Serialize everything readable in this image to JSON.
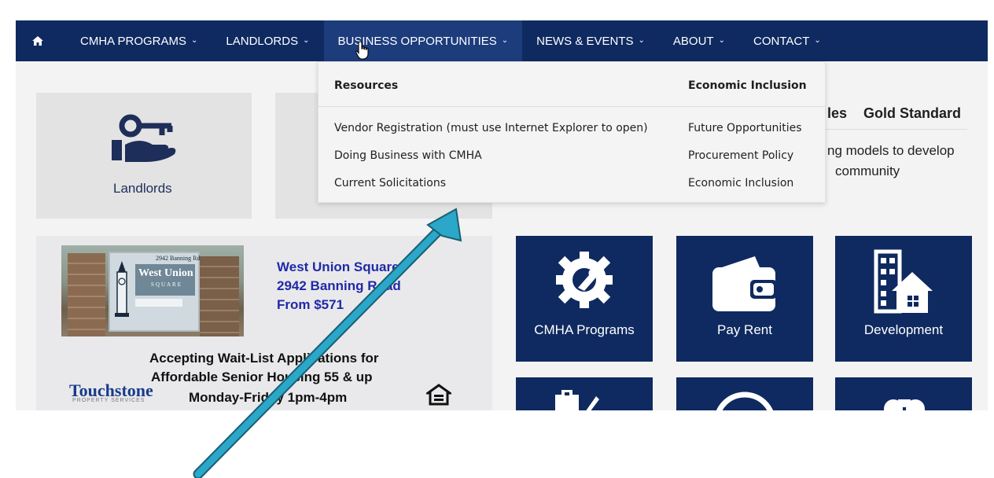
{
  "nav": {
    "home_icon": "home-icon",
    "items": [
      {
        "label": "CMHA PROGRAMS"
      },
      {
        "label": "LANDLORDS"
      },
      {
        "label": "BUSINESS OPPORTUNITIES"
      },
      {
        "label": "NEWS & EVENTS"
      },
      {
        "label": "ABOUT"
      },
      {
        "label": "CONTACT"
      }
    ],
    "caret": "⌄"
  },
  "dropdown": {
    "col1_header": "Resources",
    "col2_header": "Economic Inclusion",
    "col1_links": [
      "Vendor Registration (must use Internet Explorer to open)",
      "Doing Business with CMHA",
      "Current Solicitations"
    ],
    "col2_links": [
      "Future Opportunities",
      "Procurement Policy",
      "Economic Inclusion"
    ]
  },
  "tiles": {
    "landlords_label": "Landlords",
    "blue": [
      {
        "label": "CMHA Programs",
        "icon": "gear-wrench-icon"
      },
      {
        "label": "Pay Rent",
        "icon": "wallet-icon"
      },
      {
        "label": "Development",
        "icon": "building-home-icon"
      }
    ]
  },
  "right": {
    "tab_partial": "les",
    "tab_gold": "Gold Standard",
    "line1": "ng models to develop",
    "line2": "community"
  },
  "banner": {
    "sign_address": "2942 Banning Rd",
    "sign_name": "West Union",
    "sign_sub": "SQUARE",
    "title": "West Union Square",
    "address": "2942 Banning Road",
    "price": "From $571",
    "line1": "Accepting Wait-List Applications for",
    "line2": "Affordable Senior Housing  55 & up",
    "line3": "Monday-Friday 1pm-4pm",
    "brand": "Touchstone",
    "brand_sub": "PROPERTY SERVICES"
  },
  "colors": {
    "nav_bg": "#0f2a60",
    "arrow": "#2aa7c9"
  }
}
